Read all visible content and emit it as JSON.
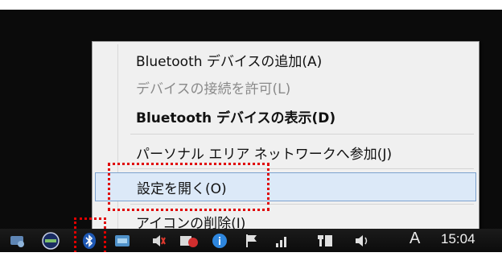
{
  "context_menu": {
    "items": [
      {
        "label": "Bluetooth デバイスの追加(A)",
        "state": "normal"
      },
      {
        "label": "デバイスの接続を許可(L)",
        "state": "disabled"
      },
      {
        "label": "Bluetooth デバイスの表示(D)",
        "state": "bold"
      },
      {
        "label": "パーソナル エリア ネットワークへ参加(J)",
        "state": "normal"
      },
      {
        "label": "設定を開く(O)",
        "state": "highlighted"
      },
      {
        "label": "アイコンの削除(I)",
        "state": "normal"
      }
    ]
  },
  "taskbar": {
    "ime_indicator": "A",
    "clock": "15:04",
    "tray_icons": [
      "network-app-icon",
      "gauge-app-icon",
      "bluetooth-icon",
      "app-window-icon",
      "speaker-mute-icon",
      "pdf-app-icon",
      "info-icon",
      "action-center-flag-icon",
      "signal-bars-icon",
      "network-adapter-icon",
      "volume-icon"
    ]
  },
  "colors": {
    "annotation_red": "#e00000",
    "menu_selection": "#dce9f8",
    "taskbar_bg": "#0b0b0b"
  }
}
